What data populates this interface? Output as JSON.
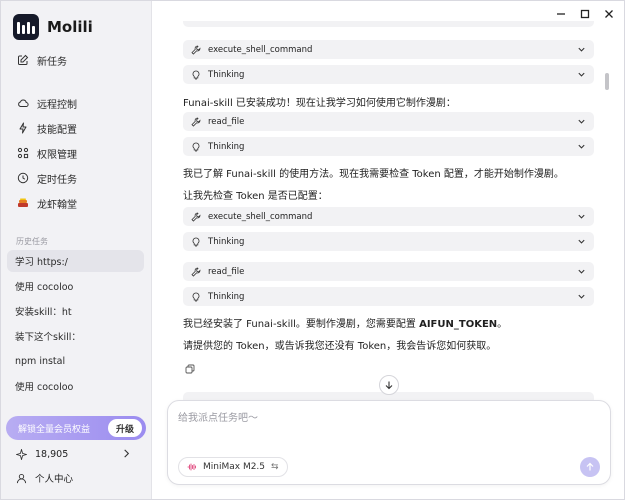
{
  "app": {
    "name": "Molili"
  },
  "sidebar": {
    "new_task": "新任务",
    "menu": [
      {
        "label": "远程控制",
        "icon": "cloud-icon"
      },
      {
        "label": "技能配置",
        "icon": "lightning-icon"
      },
      {
        "label": "权限管理",
        "icon": "grid-icon"
      },
      {
        "label": "定时任务",
        "icon": "clock-icon"
      },
      {
        "label": "龙虾翰堂",
        "icon": "lobster-icon"
      }
    ],
    "history_label": "历史任务",
    "history": [
      {
        "label": "学习 https:/",
        "active": true
      },
      {
        "label": "使用 cocoloo",
        "active": false
      },
      {
        "label": "安装skill：ht",
        "active": false
      },
      {
        "label": "装下这个skill：",
        "active": false
      },
      {
        "label": "npm instal",
        "active": false
      },
      {
        "label": "使用 cocoloo",
        "active": false
      }
    ],
    "vip_label": "解锁全量会员权益",
    "upgrade_label": "升级",
    "points": "18,905",
    "user_center": "个人中心"
  },
  "chat": {
    "items": [
      {
        "kind": "chip",
        "label": "execute_shell_command",
        "icon": "wrench-icon"
      },
      {
        "kind": "chip",
        "label": "Thinking",
        "icon": "lightbulb-icon"
      },
      {
        "kind": "msg",
        "text": "Funai-skill 已安装成功！现在让我学习如何使用它制作漫剧："
      },
      {
        "kind": "chip",
        "label": "read_file",
        "icon": "wrench-icon"
      },
      {
        "kind": "chip",
        "label": "Thinking",
        "icon": "lightbulb-icon"
      },
      {
        "kind": "msg",
        "text": "我已了解 Funai-skill 的使用方法。现在我需要检查 Token 配置，才能开始制作漫剧。"
      },
      {
        "kind": "msg",
        "text": "让我先检查 Token 是否已配置："
      },
      {
        "kind": "chip",
        "label": "execute_shell_command",
        "icon": "wrench-icon"
      },
      {
        "kind": "chip",
        "label": "Thinking",
        "icon": "lightbulb-icon"
      },
      {
        "kind": "chip",
        "label": "read_file",
        "icon": "wrench-icon"
      },
      {
        "kind": "chip",
        "label": "Thinking",
        "icon": "lightbulb-icon"
      }
    ],
    "final_msg_prefix": "我已经安装了 Funai-skill。要制作漫剧，您需要配置 ",
    "final_msg_token": "AIFUN_TOKEN",
    "final_msg_suffix": "。",
    "final_msg_2": "请提供您的 Token，或告诉我您还没有 Token，我会告诉您如何获取。"
  },
  "composer": {
    "placeholder": "给我派点任务吧～",
    "model": "MiniMax M2.5",
    "model_switch_icon": "⇆"
  },
  "colors": {
    "accent": "#9b8cf0",
    "sidebar_bg": "#f2f2f5",
    "chip_bg": "#f2f2f4"
  }
}
